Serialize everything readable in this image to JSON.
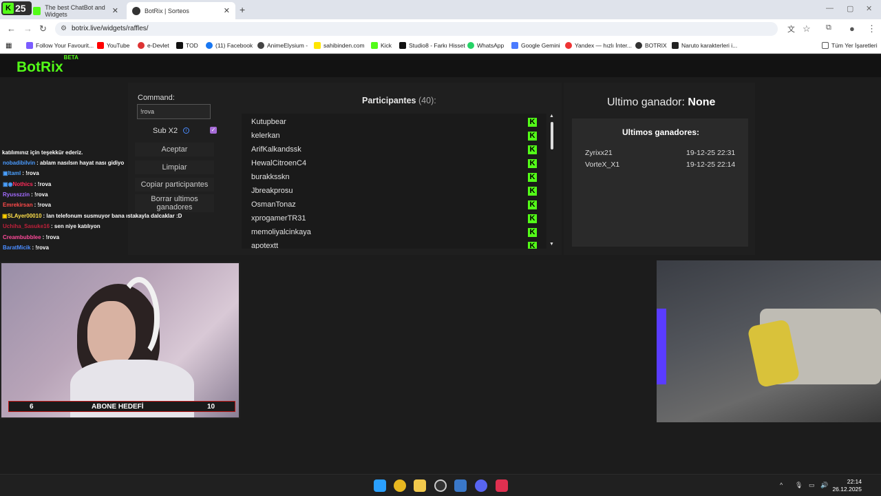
{
  "browser": {
    "tabs": [
      {
        "title": "The best ChatBot and Widgets"
      },
      {
        "title": "BotRix | Sorteos"
      }
    ],
    "extension_badge": "25",
    "url": "botrix.live/widgets/raffles/",
    "bookmarks": [
      {
        "label": "Follow Your Favourit..."
      },
      {
        "label": "YouTube"
      },
      {
        "label": "e-Devlet"
      },
      {
        "label": "TOD"
      },
      {
        "label": "(11) Facebook"
      },
      {
        "label": "AnimeElysium -"
      },
      {
        "label": "sahibinden.com"
      },
      {
        "label": "Kick"
      },
      {
        "label": "Studio8 - Farkı Hisset"
      },
      {
        "label": "WhatsApp"
      },
      {
        "label": "Google Gemini"
      },
      {
        "label": "Yandex — hızlı İnter..."
      },
      {
        "label": "BOTRIX"
      },
      {
        "label": "Naruto karakterleri i..."
      },
      {
        "label": "Tüm Yer İşaretleri"
      }
    ]
  },
  "app": {
    "logo": "BotRix",
    "logo_badge": "BETA",
    "command_label": "Command:",
    "command_value": "!rova",
    "sub_label": "Sub X2",
    "buttons": [
      "Aceptar",
      "Limpiar",
      "Copiar participantes",
      "Borrar ultimos ganadores"
    ],
    "participants_title": "Participantes",
    "participants_count": "(40):",
    "participants": [
      "Kutupbear",
      "kelerkan",
      "ArifKalkandssk",
      "HewalCitroenC4",
      "burakksskn",
      "Jbreakprosu",
      "OsmanTonaz",
      "xprogamerTR31",
      "memoliyalcinkaya",
      "apotextt"
    ],
    "last_winner_label": "Ultimo ganador:",
    "last_winner_value": "None",
    "winners_title": "Ultimos ganadores:",
    "winners": [
      {
        "name": "Zyrixx21",
        "date": "19-12-25 22:31"
      },
      {
        "name": "VorteX_X1",
        "date": "19-12-25 22:14"
      }
    ]
  },
  "chat": [
    {
      "user": "",
      "msg": "katılımınız için teşekkür ederiz.",
      "color": "#ffffff"
    },
    {
      "user": "nobadibilvin",
      "msg": ": ablam nasılsın hayat nası gidiyo",
      "color": "#4a9bff"
    },
    {
      "user": "Itaml",
      "msg": ": !rova",
      "color": "#4aa0ff"
    },
    {
      "user": "Nothics",
      "msg": ": !rova",
      "color": "#ff2a5a"
    },
    {
      "user": "Ryusszzin",
      "msg": ": !rova",
      "color": "#a46cff"
    },
    {
      "user": "Emrekirsan",
      "msg": ": !rova",
      "color": "#ff4a4a"
    },
    {
      "user": "SLAyer00010",
      "msg": ": lan telefonum susmuyor bana ıstakayla dalcaklar :D",
      "color": "#ffe04a"
    },
    {
      "user": "Uchiha_Sasuke16",
      "msg": ": sen niye katılıyon",
      "color": "#c0203a"
    },
    {
      "user": "Creambubblee",
      "msg": ": !rova",
      "color": "#ff4a9a"
    },
    {
      "user": "BaratMicik",
      "msg": ": !rova",
      "color": "#4a8cff"
    }
  ],
  "stream": {
    "goal_start": "6",
    "goal_label": "ABONE HEDEFİ",
    "goal_end": "10"
  },
  "taskbar": {
    "time": "22:14",
    "date": "26.12.2025"
  },
  "colors": {
    "kick_green": "#53fc18",
    "page_bg": "#1c1c1c",
    "panel_bg": "#1f1f1f"
  }
}
